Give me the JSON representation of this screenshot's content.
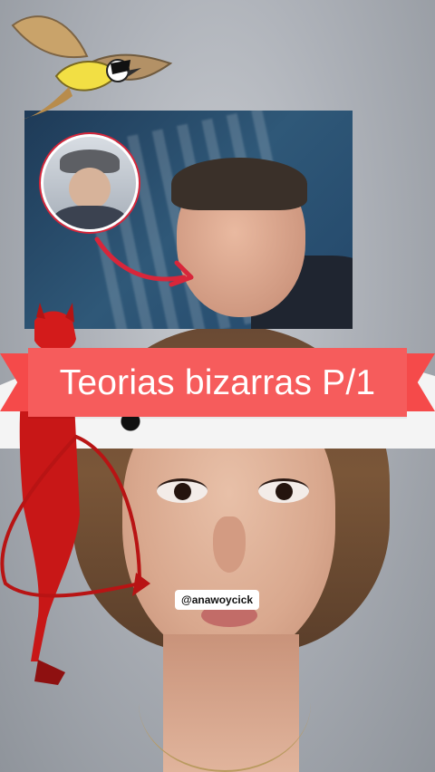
{
  "banner": {
    "title": "Teorias bizarras P/1"
  },
  "watermark": {
    "handle": "@anawoycick"
  },
  "stickers": {
    "bird_icon": "bird-sticker",
    "devil_icon": "devil-sticker"
  },
  "colors": {
    "banner": "#f65c5c",
    "inset_ring": "#d8263a",
    "arrow": "#d8263a"
  }
}
